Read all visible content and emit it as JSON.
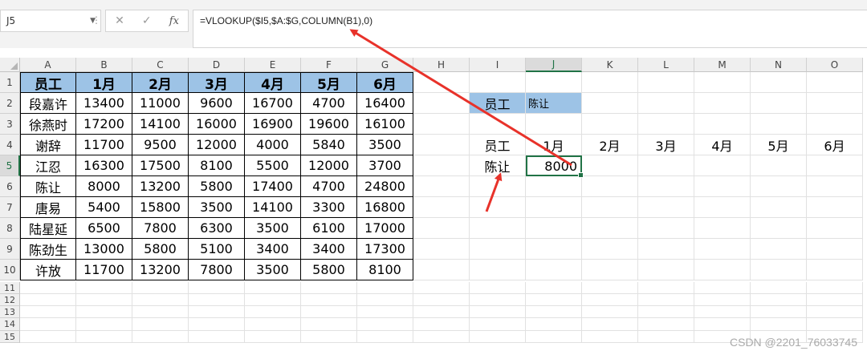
{
  "formula_bar": {
    "name_box": "J5",
    "cancel_icon": "✕",
    "enter_icon": "✓",
    "fx_label": "fx",
    "formula": "=VLOOKUP($I5,$A:$G,COLUMN(B1),0)"
  },
  "columns": [
    "A",
    "B",
    "C",
    "D",
    "E",
    "F",
    "G",
    "H",
    "I",
    "J",
    "K",
    "L",
    "M",
    "N",
    "O"
  ],
  "rows": [
    "1",
    "2",
    "3",
    "4",
    "5",
    "6",
    "7",
    "8",
    "9",
    "10",
    "11",
    "12",
    "13",
    "14",
    "15"
  ],
  "table": {
    "header": [
      "员工",
      "1月",
      "2月",
      "3月",
      "4月",
      "5月",
      "6月"
    ],
    "rows": [
      [
        "段嘉许",
        "13400",
        "11000",
        "9600",
        "16700",
        "4700",
        "16400"
      ],
      [
        "徐燕时",
        "17200",
        "14100",
        "16000",
        "16900",
        "19600",
        "16100"
      ],
      [
        "谢辞",
        "11700",
        "9500",
        "12000",
        "4000",
        "5840",
        "3500"
      ],
      [
        "江忍",
        "16300",
        "17500",
        "8100",
        "5500",
        "12000",
        "3700"
      ],
      [
        "陈让",
        "8000",
        "13200",
        "5800",
        "17400",
        "4700",
        "24800"
      ],
      [
        "唐易",
        "5400",
        "15800",
        "3500",
        "14100",
        "3300",
        "16800"
      ],
      [
        "陆星延",
        "6500",
        "7800",
        "6300",
        "3500",
        "6100",
        "17000"
      ],
      [
        "陈劲生",
        "13000",
        "5800",
        "5100",
        "3400",
        "3400",
        "17300"
      ],
      [
        "许放",
        "11700",
        "13200",
        "7800",
        "3500",
        "5800",
        "8100"
      ]
    ]
  },
  "lookup": {
    "input_label": "员工",
    "input_value": "陈让",
    "header_label": "员工",
    "months": [
      "1月",
      "2月",
      "3月",
      "4月",
      "5月",
      "6月"
    ],
    "row_name": "陈让",
    "result": "8000"
  },
  "watermark": "CSDN @2201_76033745",
  "colors": {
    "header_fill": "#9dc3e6",
    "selection": "#217346",
    "arrow": "#e8322a"
  }
}
